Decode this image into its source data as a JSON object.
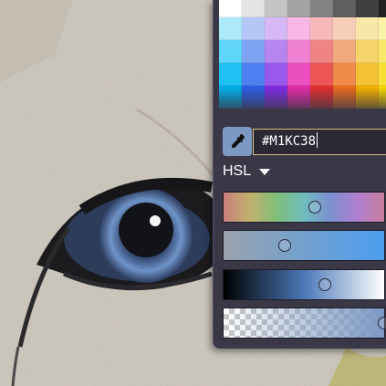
{
  "color_picker": {
    "hex_value": "#M1KC38",
    "mode_label": "HSL",
    "swatch_colors": [
      [
        "#ffffff",
        "#e4e4e4",
        "#c4c4c4",
        "#a3a3a3",
        "#828282",
        "#5f5f5f",
        "#404040",
        "#202020"
      ],
      [
        "#abe9fb",
        "#b4c7f7",
        "#d7b8f7",
        "#f7b8e6",
        "#f7b8b8",
        "#f7cfb8",
        "#f9e7a9",
        "#fbf2a9"
      ],
      [
        "#5fd6f9",
        "#7ea3f2",
        "#b585f0",
        "#f081d2",
        "#f08484",
        "#f2a97e",
        "#f6d46a",
        "#f9e86b"
      ],
      [
        "#1fc2f3",
        "#4f7ff0",
        "#9b58ec",
        "#ec4fbf",
        "#ec5656",
        "#ef8a4a",
        "#f4c236",
        "#f7df36"
      ],
      [
        "#00aee6",
        "#2c5ee0",
        "#7d2de0",
        "#e02ba6",
        "#e02f2f",
        "#e86b1f",
        "#f0af00",
        "#f2d600"
      ]
    ],
    "accent_color": "#7c99c4",
    "sliders": [
      {
        "name": "hue",
        "value_percent": 57
      },
      {
        "name": "saturation",
        "value_percent": 38
      },
      {
        "name": "lightness",
        "value_percent": 63
      },
      {
        "name": "alpha",
        "value_percent": 100
      }
    ]
  },
  "icons": {
    "eyedropper": "eyedropper-icon",
    "mode_dropdown": "caret-down-icon"
  }
}
